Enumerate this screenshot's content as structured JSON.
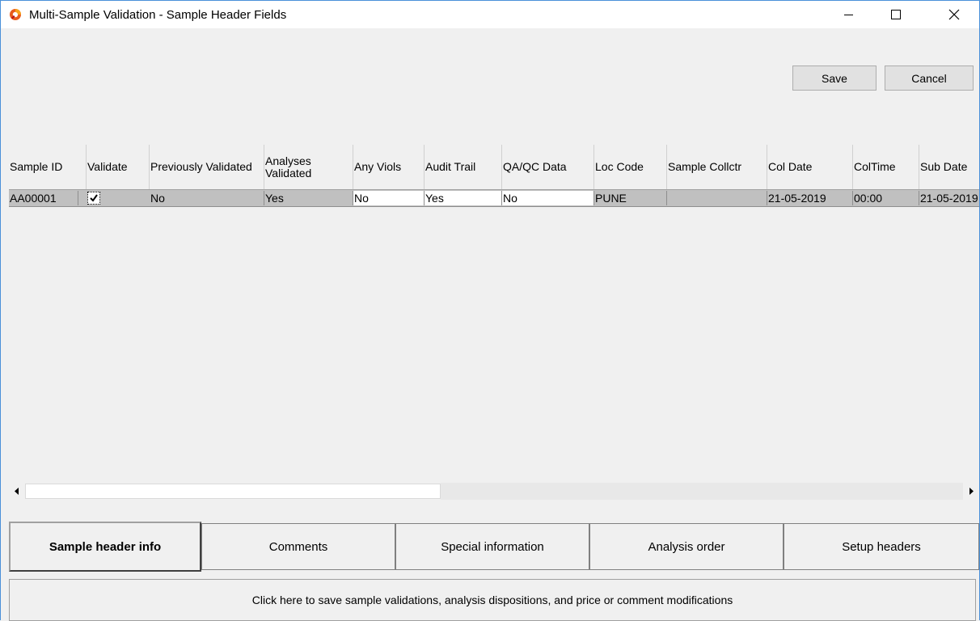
{
  "window": {
    "title": "Multi-Sample Validation - Sample Header Fields",
    "accent_color": "#e85c1c"
  },
  "toolbar": {
    "save_label": "Save",
    "cancel_label": "Cancel"
  },
  "grid": {
    "columns": [
      "Sample ID",
      "Validate",
      "Previously Validated",
      "Analyses Validated",
      "Any Viols",
      "Audit Trail",
      "QA/QC Data",
      "Loc Code",
      "Sample Collctr",
      "Col Date",
      "ColTime",
      "Sub Date"
    ],
    "rows": [
      {
        "sample_id": "AA00001",
        "validate_checked": true,
        "previously_validated": "No",
        "analyses_validated": "Yes",
        "any_viols": "No",
        "audit_trail": "Yes",
        "qaqc_data": "No",
        "loc_code": "PUNE",
        "sample_collctr": "",
        "col_date": "21-05-2019",
        "col_time": "00:00",
        "sub_date": "21-05-2019"
      }
    ]
  },
  "tabs": [
    "Sample header info",
    "Comments",
    "Special information",
    "Analysis order",
    "Setup headers"
  ],
  "active_tab": "Sample header info",
  "status_text": "Click here to save sample validations, analysis dispositions, and price or comment modifications"
}
